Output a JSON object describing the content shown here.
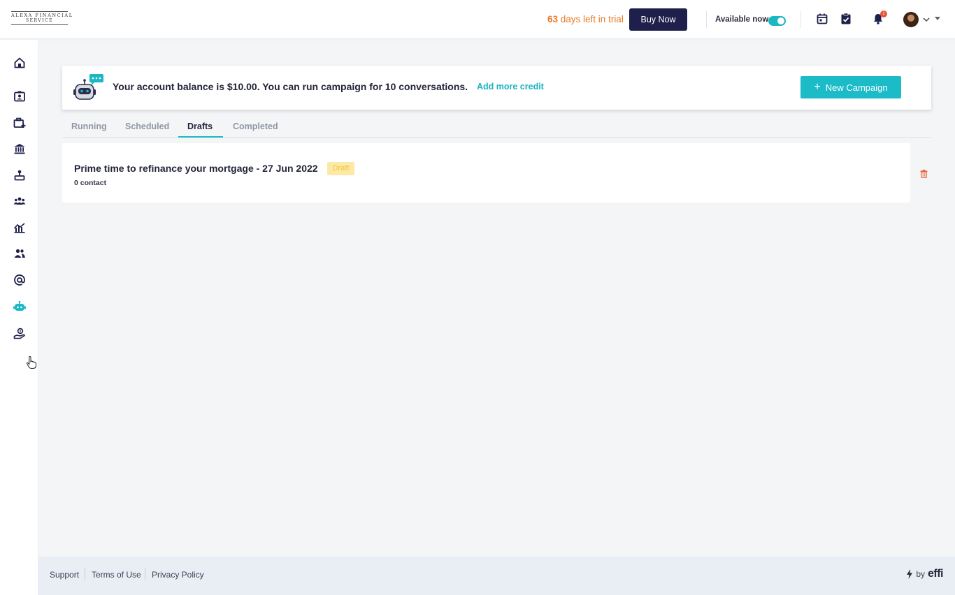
{
  "header": {
    "logo_line1": "ALEXA FINANCIAL",
    "logo_line2": "SERVICE",
    "trial_days": "63",
    "trial_text": " days left in trial",
    "buy_label": "Buy Now",
    "availability_label": "Available now",
    "availability_on": true,
    "notification_count": "1"
  },
  "banner": {
    "message": "Your account balance is $10.00. You can run campaign for 10 conversations.",
    "link_label": "Add more credit",
    "button_label": "New Campaign"
  },
  "tabs": [
    {
      "label": "Running",
      "active": false
    },
    {
      "label": "Scheduled",
      "active": false
    },
    {
      "label": "Drafts",
      "active": true
    },
    {
      "label": "Completed",
      "active": false
    }
  ],
  "campaigns": [
    {
      "title": "Prime time to refinance your mortgage - 27 Jun 2022",
      "status": "Draft",
      "contacts": "0 contact"
    }
  ],
  "footer": {
    "links": [
      "Support",
      "Terms of Use",
      "Privacy Policy"
    ],
    "powered_by": "by",
    "brand": "effi"
  },
  "colors": {
    "accent": "#1bb8c4",
    "primary_dark": "#1e1f4b",
    "trial_orange": "#e87b2a",
    "draft_yellow": "#fde9a6"
  }
}
